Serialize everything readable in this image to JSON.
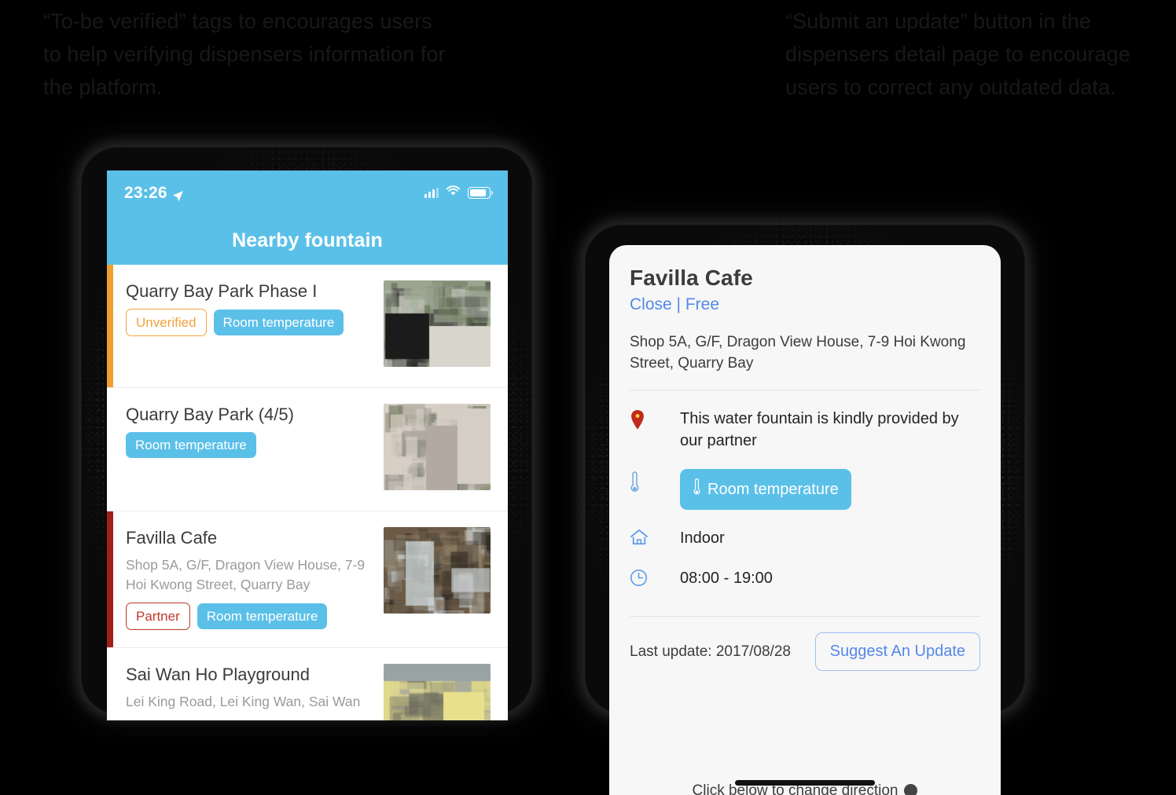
{
  "captions": {
    "left": "“To-be verified” tags to encourages users to help verifying dispensers information for the platform.",
    "right": "“Submit an update” button in the dispensers detail page to encourage users to correct any outdated data."
  },
  "colors": {
    "accent_blue": "#5BC0E8",
    "link_blue": "#5488E8",
    "unverified_orange": "#F0A33C",
    "partner_red": "#C0392B",
    "stripe_orange": "#F0A030",
    "stripe_red": "#A02018",
    "pin_red": "#C0291B",
    "card_bg": "#F7F7F8",
    "background": "#000000"
  },
  "phone": {
    "status_bar": {
      "time": "23:26",
      "location_icon": "location-arrow-icon",
      "signal_icon": "cellular-signal-icon",
      "wifi_icon": "wifi-icon",
      "battery_icon": "battery-icon"
    },
    "nav_title": "Nearby fountain",
    "list": [
      {
        "title": "Quarry Bay Park Phase I",
        "address": "",
        "stripe": "#F0A030",
        "tags": [
          {
            "label": "Unverified",
            "style": "out-orange"
          },
          {
            "label": "Room temperature",
            "style": "solid-blue"
          }
        ],
        "thumb": "outdoor-fountain-row-photo"
      },
      {
        "title": "Quarry Bay Park (4/5)",
        "address": "",
        "stripe": "",
        "tags": [
          {
            "label": "Room temperature",
            "style": "solid-blue"
          }
        ],
        "thumb": "stone-fountain-photo"
      },
      {
        "title": "Favilla Cafe",
        "address": "Shop 5A, G/F, Dragon View House, 7-9 Hoi Kwong Street, Quarry Bay",
        "stripe": "#A02018",
        "tags": [
          {
            "label": "Partner",
            "style": "out-red"
          },
          {
            "label": "Room temperature",
            "style": "solid-blue"
          }
        ],
        "thumb": "cafe-bottle-glasses-photo"
      },
      {
        "title": "Sai Wan Ho Playground",
        "address": "Lei King Road, Lei King Wan, Sai Wan",
        "stripe": "",
        "tags": [],
        "thumb": "indoor-yellow-room-photo"
      }
    ]
  },
  "detail_card": {
    "title": "Favilla Cafe",
    "subtitle": "Close | Free",
    "address": "Shop 5A, G/F, Dragon View House, 7-9 Hoi Kwong Street, Quarry Bay",
    "rows": [
      {
        "icon": "map-pin-icon",
        "text": "This water fountain is kindly provided by our partner"
      },
      {
        "icon": "thermometer-icon",
        "badge": "Room temperature",
        "badge_icon": "thermometer-icon"
      },
      {
        "icon": "home-icon",
        "text": "Indoor"
      },
      {
        "icon": "clock-icon",
        "text": "08:00 - 19:00"
      }
    ],
    "last_update": "Last update: 2017/08/28",
    "update_button": "Suggest An Update",
    "cut_off_text": "Click below to change direction"
  }
}
